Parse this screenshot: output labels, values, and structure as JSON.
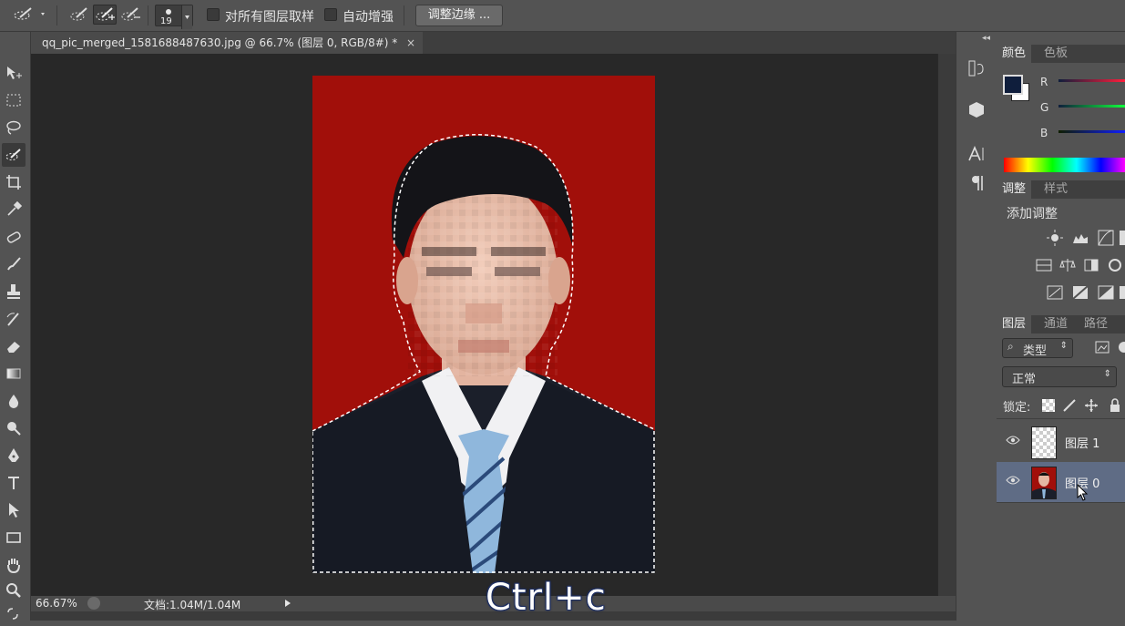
{
  "options_bar": {
    "brush_size": "19",
    "sample_all_layers": "对所有图层取样",
    "auto_enhance": "自动增强",
    "refine_edge": "调整边缘 ..."
  },
  "document": {
    "tab_title": "qq_pic_merged_1581688487630.jpg @ 66.7% (图层 0, RGB/8#) *",
    "zoom": "66.67%",
    "doc_size": "文档:1.04M/1.04M",
    "overlay_caption": "Ctrl+c"
  },
  "color_panel": {
    "tabs": [
      "颜色",
      "色板"
    ],
    "channels": [
      "R",
      "G",
      "B"
    ],
    "foreground_color": "#0f1e3c",
    "background_color": "#ffffff"
  },
  "adjustments_panel": {
    "tabs": [
      "调整",
      "样式"
    ],
    "heading": "添加调整"
  },
  "layers_panel": {
    "tabs": [
      "图层",
      "通道",
      "路径"
    ],
    "filter_kind": "类型",
    "blend_mode": "正常",
    "lock_label": "锁定:",
    "layers": [
      {
        "name": "图层 1",
        "selected": false
      },
      {
        "name": "图层 0",
        "selected": true
      }
    ]
  },
  "colors": {
    "background_red": "#a10f0a",
    "suit": "#1b1f2a",
    "tie": "#8fb7dc",
    "ui_dark": "#535353"
  }
}
